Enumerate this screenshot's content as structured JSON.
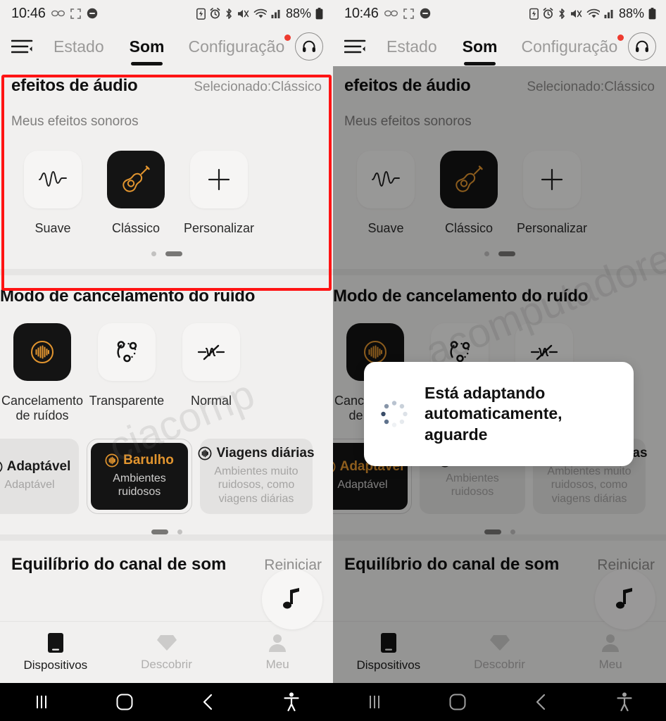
{
  "statusbar": {
    "time": "10:46",
    "battery_pct": "88%",
    "icons_left": [
      "glasses-icon",
      "dotted-square-icon",
      "do-not-disturb-icon"
    ],
    "icons_right": [
      "battery-saver-icon",
      "alarm-icon",
      "bluetooth-icon",
      "mute-icon",
      "wifi-icon",
      "signal-icon"
    ]
  },
  "topnav": {
    "menu_icon": "hamburger-icon",
    "tabs": [
      {
        "label": "Estado",
        "active": false
      },
      {
        "label": "Som",
        "active": true
      },
      {
        "label": "Configuração",
        "active": false,
        "badge": true
      }
    ],
    "headphone_icon": "headphone-icon"
  },
  "audio_effects": {
    "title": "efeitos de áudio",
    "selected_text": "Selecionado:Clássico",
    "subtitle": "Meus efeitos sonoros",
    "tiles": [
      {
        "label": "Suave",
        "icon": "waveform-icon",
        "selected": false
      },
      {
        "label": "Clássico",
        "icon": "guitar-icon",
        "selected": true
      },
      {
        "label": "Personalizar",
        "icon": "plus-icon",
        "selected": false
      }
    ],
    "pager": {
      "count": 2,
      "active_index": 1
    }
  },
  "noise": {
    "title": "Modo de cancelamento do ruído",
    "modes": [
      {
        "label": "Cancelamento de ruídos",
        "icon": "anc-icon",
        "selected": true
      },
      {
        "label": "Transparente",
        "icon": "transparency-icon",
        "selected": false
      },
      {
        "label": "Normal",
        "icon": "noise-off-icon",
        "selected": false
      }
    ],
    "chips_left": [
      {
        "title": "Adaptável",
        "sub": "Adaptável",
        "icon": "anc-level-icon",
        "selected": false
      },
      {
        "title": "Barulho",
        "sub": "Ambientes ruidosos",
        "icon": "anc-level-icon",
        "selected": true
      },
      {
        "title": "Viagens diárias",
        "sub": "Ambientes muito ruidosos, como viagens diárias",
        "icon": "anc-level-icon",
        "selected": false
      }
    ],
    "chips_right": [
      {
        "title": "Adaptável",
        "sub": "Adaptável",
        "icon": "anc-level-icon",
        "selected": true
      },
      {
        "title": "Barulho",
        "sub": "Ambientes ruidosos",
        "icon": "anc-level-icon",
        "selected": false
      },
      {
        "title": "Viagens diárias",
        "sub": "Ambientes muito ruidosos, como viagens diárias",
        "icon": "anc-level-icon",
        "selected": false
      }
    ],
    "pager": {
      "count": 2,
      "active_index": 0
    }
  },
  "fab": {
    "icon": "music-note-icon"
  },
  "balance": {
    "title": "Equilíbrio do canal de som",
    "reset": "Reiniciar"
  },
  "bottomnav": [
    {
      "label": "Dispositivos",
      "icon": "device-icon",
      "active": true
    },
    {
      "label": "Descobrir",
      "icon": "diamond-icon",
      "active": false
    },
    {
      "label": "Meu",
      "icon": "person-icon",
      "active": false
    }
  ],
  "sysbar": [
    "recents-icon",
    "home-icon",
    "back-icon",
    "accessibility-icon"
  ],
  "dialog": {
    "message": "Está adaptando automaticamente, aguarde",
    "spinner": "loading-spinner-icon"
  },
  "watermark": {
    "left": "ciacomp",
    "right": "acomputadores"
  },
  "colors": {
    "accent": "#e2952f",
    "highlight": "#ff1414",
    "dark_tile": "#141414",
    "bg": "#f1f0ef"
  }
}
